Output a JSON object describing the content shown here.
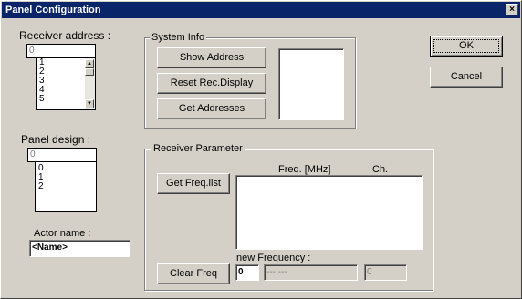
{
  "window": {
    "title": "Panel Configuration",
    "close_glyph": "×"
  },
  "receiver_address": {
    "label": "Receiver address :",
    "current": "0",
    "items": [
      "1",
      "2",
      "3",
      "4",
      "5"
    ]
  },
  "panel_design": {
    "label": "Panel design :",
    "current": "0",
    "items": [
      "0",
      "1",
      "2"
    ]
  },
  "actor": {
    "label": "Actor name :",
    "value": "<Name>"
  },
  "system_info": {
    "title": "System Info",
    "show_address": "Show Address",
    "reset_display": "Reset Rec.Display",
    "get_addresses": "Get Addresses"
  },
  "buttons": {
    "ok": "OK",
    "cancel": "Cancel"
  },
  "receiver_parameter": {
    "title": "Receiver Parameter",
    "col_freq": "Freq. [MHz]",
    "col_ch": "Ch.",
    "get_freq_list": "Get Freq.list",
    "new_frequency_label": "new Frequency :",
    "clear_freq": "Clear Freq",
    "freq_index": "0",
    "freq_value": "---.---",
    "channel_value": "0"
  },
  "icons": {
    "scroll_up": "▲",
    "scroll_down": "▼"
  }
}
